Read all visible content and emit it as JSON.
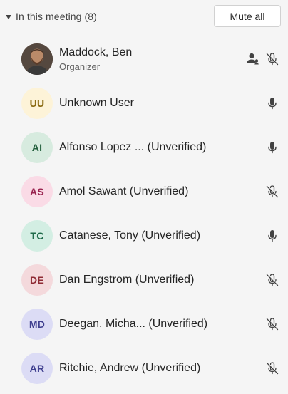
{
  "header": {
    "section_title": "In this meeting (8)",
    "mute_all_label": "Mute all"
  },
  "participants": [
    {
      "name": "Maddock, Ben",
      "role": "Organizer",
      "initials": "",
      "avatar_type": "photo",
      "mic": "muted",
      "extra_icon": "people-icon"
    },
    {
      "name": "Unknown User",
      "initials": "UU",
      "avatar_bg": "#fdf3d8",
      "avatar_fg": "#8a6a12",
      "mic": "on"
    },
    {
      "name": "Alfonso Lopez ... (Unverified)",
      "initials": "AI",
      "avatar_bg": "#d7ebdf",
      "avatar_fg": "#25613f",
      "mic": "on"
    },
    {
      "name": "Amol Sawant (Unverified)",
      "initials": "AS",
      "avatar_bg": "#fadbe6",
      "avatar_fg": "#9a2450",
      "mic": "muted"
    },
    {
      "name": "Catanese, Tony (Unverified)",
      "initials": "TC",
      "avatar_bg": "#d3eee3",
      "avatar_fg": "#1f6b4a",
      "mic": "on"
    },
    {
      "name": "Dan Engstrom (Unverified)",
      "initials": "DE",
      "avatar_bg": "#f4d9dc",
      "avatar_fg": "#8f2b35",
      "mic": "muted"
    },
    {
      "name": "Deegan, Micha... (Unverified)",
      "initials": "MD",
      "avatar_bg": "#dcdcf5",
      "avatar_fg": "#3f3f8f",
      "mic": "muted"
    },
    {
      "name": "Ritchie, Andrew (Unverified)",
      "initials": "AR",
      "avatar_bg": "#dcdcf5",
      "avatar_fg": "#3f3f8f",
      "mic": "muted"
    }
  ],
  "colors": {
    "background": "#f5f5f5",
    "text": "#242424",
    "icon": "#424242"
  }
}
